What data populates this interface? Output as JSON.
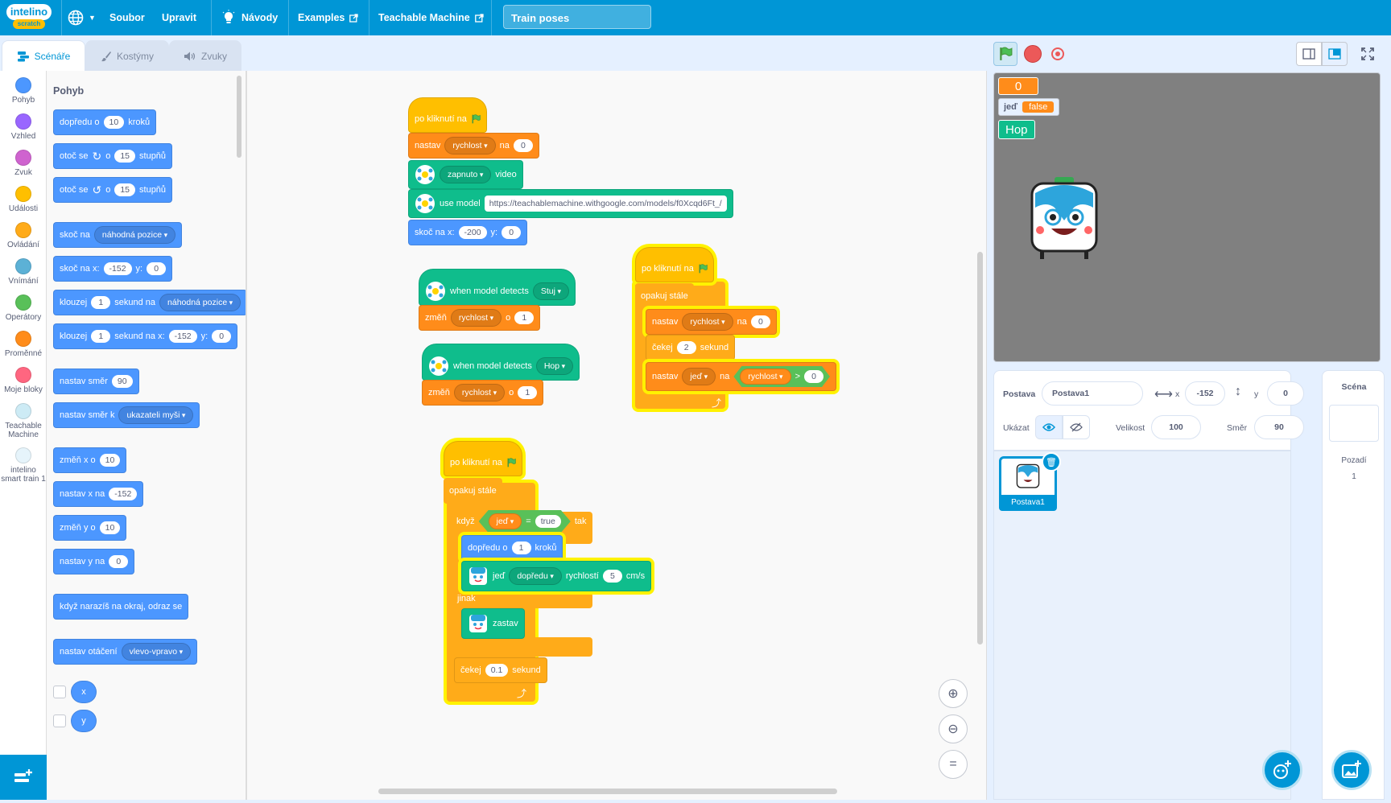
{
  "menubar": {
    "logo_top": "intelino",
    "logo_bottom": "scratch",
    "file": "Soubor",
    "edit": "Upravit",
    "tutorials": "Návody",
    "examples": "Examples",
    "teachable_machine": "Teachable Machine",
    "project_title": "Train poses"
  },
  "tabs": {
    "code": "Scénáře",
    "costumes": "Kostýmy",
    "sounds": "Zvuky"
  },
  "categories": [
    {
      "label": "Pohyb",
      "color": "#4c97ff"
    },
    {
      "label": "Vzhled",
      "color": "#9966ff"
    },
    {
      "label": "Zvuk",
      "color": "#cf63cf"
    },
    {
      "label": "Události",
      "color": "#ffbf00"
    },
    {
      "label": "Ovládání",
      "color": "#ffab19"
    },
    {
      "label": "Vnímání",
      "color": "#5cb1d6"
    },
    {
      "label": "Operátory",
      "color": "#59c059"
    },
    {
      "label": "Proměnné",
      "color": "#ff8c1a"
    },
    {
      "label": "Moje bloky",
      "color": "#ff6680"
    },
    {
      "label": "Teachable Machine",
      "color": "#0fbd8c"
    },
    {
      "label": "intelino smart train 1",
      "color": "#0096d6"
    }
  ],
  "palette": {
    "title": "Pohyb",
    "move": {
      "a": "dopředu o",
      "v": "10",
      "b": "kroků"
    },
    "turn_right": {
      "a": "otoč se",
      "b": "o",
      "v": "15",
      "c": "stupňů"
    },
    "turn_left": {
      "a": "otoč se",
      "b": "o",
      "v": "15",
      "c": "stupňů"
    },
    "goto": {
      "a": "skoč na",
      "d": "náhodná pozice"
    },
    "goto_xy": {
      "a": "skoč na x:",
      "x": "-152",
      "b": "y:",
      "y": "0"
    },
    "glide": {
      "a": "klouzej",
      "v": "1",
      "b": "sekund na",
      "d": "náhodná pozice"
    },
    "glide_xy": {
      "a": "klouzej",
      "v": "1",
      "b": "sekund na x:",
      "x": "-152",
      "c": "y:",
      "y": "0"
    },
    "point_dir": {
      "a": "nastav směr",
      "v": "90"
    },
    "point_towards": {
      "a": "nastav směr k",
      "d": "ukazateli myši"
    },
    "change_x": {
      "a": "změň x o",
      "v": "10"
    },
    "set_x": {
      "a": "nastav x na",
      "v": "-152"
    },
    "change_y": {
      "a": "změň y o",
      "v": "10"
    },
    "set_y": {
      "a": "nastav y na",
      "v": "0"
    },
    "bounce": "když narazíš na okraj, odraz se",
    "rotation": {
      "a": "nastav otáčení",
      "d": "vlevo-vpravo"
    },
    "rep_x": "x",
    "rep_y": "y"
  },
  "script1": {
    "hat": "po kliknutí na",
    "set": {
      "a": "nastav",
      "d": "rychlost",
      "b": "na",
      "v": "0"
    },
    "video": {
      "d": "zapnuto",
      "b": "video"
    },
    "model": {
      "a": "use model",
      "url": "https://teachablemachine.withgoogle.com/models/f0Xcqd6Ft_/"
    },
    "goto": {
      "a": "skoč na x:",
      "x": "-200",
      "b": "y:",
      "y": "0"
    }
  },
  "script2": {
    "hat": "when model detects",
    "d": "Stuj",
    "change": {
      "a": "změň",
      "d": "rychlost",
      "b": "o",
      "v": "1"
    }
  },
  "script3": {
    "hat": "when model detects",
    "d": "Hop",
    "change": {
      "a": "změň",
      "d": "rychlost",
      "b": "o",
      "v": "1"
    }
  },
  "script4": {
    "hat": "po kliknutí na",
    "forever": "opakuj stále",
    "set": {
      "a": "nastav",
      "d": "rychlost",
      "b": "na",
      "v": "0"
    },
    "wait": {
      "a": "čekej",
      "v": "2",
      "b": "sekund"
    },
    "set2": {
      "a": "nastav",
      "d": "jeď",
      "b": "na",
      "var": "rychlost",
      "op": ">",
      "v": "0"
    }
  },
  "script5": {
    "hat": "po kliknutí na",
    "forever": "opakuj stále",
    "if": {
      "a": "když",
      "var": "jeď",
      "op": "=",
      "v": "true",
      "b": "tak"
    },
    "move": {
      "a": "dopředu o",
      "v": "1",
      "b": "kroků"
    },
    "drive": {
      "a": "jeď",
      "d": "dopředu",
      "b": "rychlostí",
      "v": "5",
      "c": "cm/s"
    },
    "else": "jinak",
    "stop": "zastav",
    "wait": {
      "a": "čekej",
      "v": "0.1",
      "b": "sekund"
    }
  },
  "stage": {
    "score": "0",
    "monitor_label": "jeď",
    "monitor_value": "false",
    "hop_label": "Hop"
  },
  "sprite_info": {
    "sprite_label": "Postava",
    "sprite_name": "Postava1",
    "x_label": "x",
    "x": "-152",
    "y_label": "y",
    "y": "0",
    "show_label": "Ukázat",
    "size_label": "Velikost",
    "size": "100",
    "direction_label": "Směr",
    "direction": "90"
  },
  "sprite_tile": "Postava1",
  "stage_pane": {
    "title": "Scéna",
    "backdrops_label": "Pozadí",
    "backdrops_count": "1"
  }
}
